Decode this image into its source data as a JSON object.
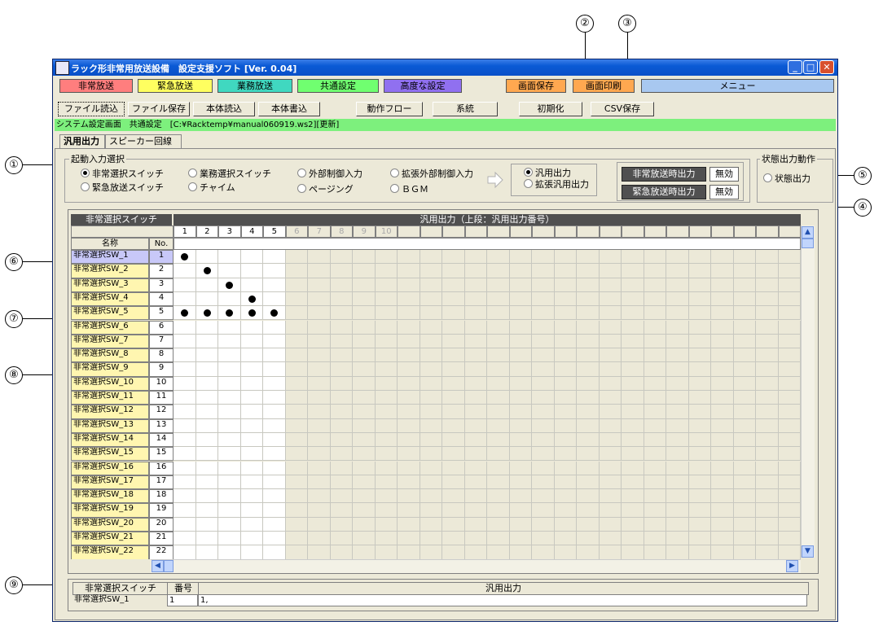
{
  "callouts": [
    "①",
    "②",
    "③",
    "④",
    "⑤",
    "⑥",
    "⑦",
    "⑧",
    "⑨"
  ],
  "window": {
    "title": "ラック形非常用放送設備　設定支援ソフト [Ver. 0.04]",
    "min": "_",
    "max": "□",
    "close": "✕"
  },
  "topbar": [
    {
      "label": "非常放送",
      "bg": "#ff7e7e"
    },
    {
      "label": "緊急放送",
      "bg": "#ffff60"
    },
    {
      "label": "業務放送",
      "bg": "#40d8c0"
    },
    {
      "label": "共通設定",
      "bg": "#70ff70"
    },
    {
      "label": "高度な設定",
      "bg": "#9070f0"
    },
    {
      "label": "画面保存",
      "bg": "#ffa850"
    },
    {
      "label": "画面印刷",
      "bg": "#ffa850"
    },
    {
      "label": "メニュー",
      "bg": "#a8c8f0"
    }
  ],
  "toolbar": [
    "ファイル読込",
    "ファイル保存",
    "本体読込",
    "本体書込",
    "動作フロー",
    "系統",
    "初期化",
    "CSV保存"
  ],
  "status_text": "システム設定画面　共通設定　[C:¥Racktemp¥manual060919.ws2][更新]",
  "tabs": [
    "汎用出力",
    "スピーカー回線"
  ],
  "trigger_group": {
    "title": "起動入力選択",
    "options": [
      "非常選択スイッチ",
      "業務選択スイッチ",
      "外部制御入力",
      "拡張外部制御入力",
      "緊急放送スイッチ",
      "チャイム",
      "ページング",
      "ＢＧＭ"
    ],
    "selected": "非常選択スイッチ"
  },
  "output_options": [
    "汎用出力",
    "拡張汎用出力"
  ],
  "output_selected": "汎用出力",
  "emergency_output": {
    "label": "非常放送時出力",
    "value": "無効"
  },
  "urgent_output": {
    "label": "緊急放送時出力",
    "value": "無効"
  },
  "state_group": {
    "title": "状態出力動作",
    "option": "状態出力"
  },
  "grid": {
    "left_header": "非常選択スイッチ",
    "right_header": "汎用出力（上段：汎用出力番号）",
    "name_header": "名称",
    "no_header": "No.",
    "columns": [
      "1",
      "2",
      "3",
      "4",
      "5",
      "6",
      "7",
      "8",
      "9",
      "10"
    ],
    "enabled_columns": 5,
    "rows": [
      {
        "name": "非常選択SW_1",
        "no": "1"
      },
      {
        "name": "非常選択SW_2",
        "no": "2"
      },
      {
        "name": "非常選択SW_3",
        "no": "3"
      },
      {
        "name": "非常選択SW_4",
        "no": "4"
      },
      {
        "name": "非常選択SW_5",
        "no": "5"
      },
      {
        "name": "非常選択SW_6",
        "no": "6"
      },
      {
        "name": "非常選択SW_7",
        "no": "7"
      },
      {
        "name": "非常選択SW_8",
        "no": "8"
      },
      {
        "name": "非常選択SW_9",
        "no": "9"
      },
      {
        "name": "非常選択SW_10",
        "no": "10"
      },
      {
        "name": "非常選択SW_11",
        "no": "11"
      },
      {
        "name": "非常選択SW_12",
        "no": "12"
      },
      {
        "name": "非常選択SW_13",
        "no": "13"
      },
      {
        "name": "非常選択SW_14",
        "no": "14"
      },
      {
        "name": "非常選択SW_15",
        "no": "15"
      },
      {
        "name": "非常選択SW_16",
        "no": "16"
      },
      {
        "name": "非常選択SW_17",
        "no": "17"
      },
      {
        "name": "非常選択SW_18",
        "no": "18"
      },
      {
        "name": "非常選択SW_19",
        "no": "19"
      },
      {
        "name": "非常選択SW_20",
        "no": "20"
      },
      {
        "name": "非常選択SW_21",
        "no": "21"
      },
      {
        "name": "非常選択SW_22",
        "no": "22"
      }
    ],
    "marks": [
      [
        1,
        1
      ],
      [
        2,
        2
      ],
      [
        3,
        3
      ],
      [
        4,
        4
      ],
      [
        5,
        1
      ],
      [
        5,
        2
      ],
      [
        5,
        3
      ],
      [
        5,
        4
      ],
      [
        5,
        5
      ]
    ]
  },
  "summary": {
    "headers": [
      "非常選択スイッチ",
      "番号",
      "汎用出力"
    ],
    "values": [
      "非常選択SW_1",
      "1",
      "1,"
    ]
  },
  "colors": {
    "grid_disabled": "#ece9d8",
    "status_green": "#7df07d",
    "row_yellow": "#fff6b0",
    "row_selected": "#c8c8f8"
  }
}
